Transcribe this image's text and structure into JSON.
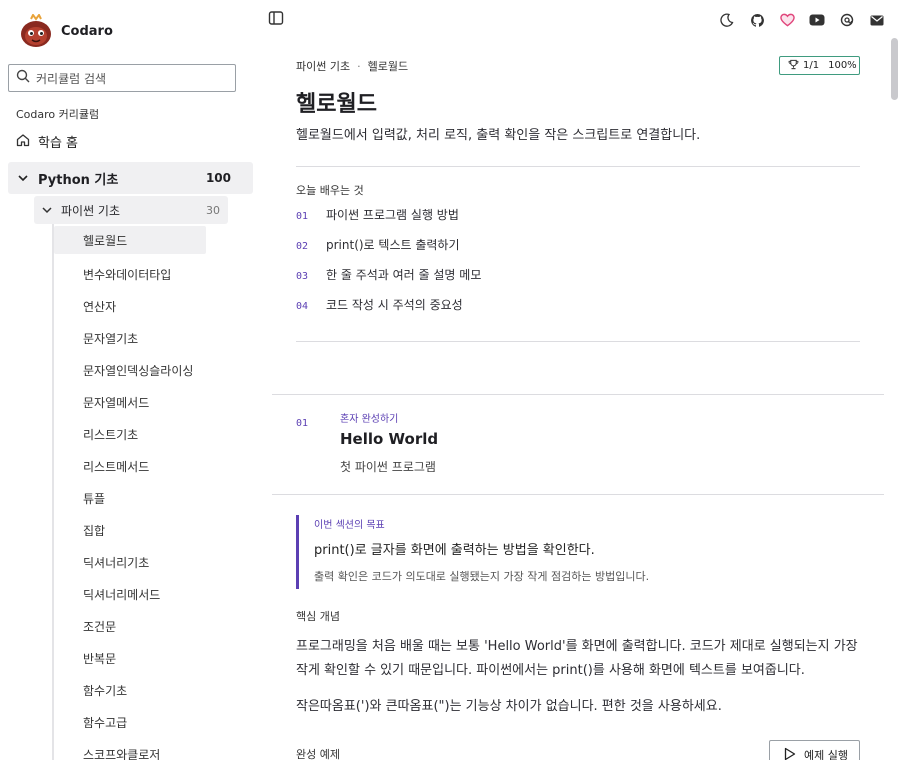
{
  "brand": {
    "name": "Codaro"
  },
  "sidebar": {
    "search_placeholder": "커리큘럼 검색",
    "curriculum_title": "Codaro 커리큘럼",
    "home_label": "학습 홈",
    "group": {
      "label": "Python 기초",
      "count": "100"
    },
    "subgroup": {
      "label": "파이썬 기초",
      "count": "30"
    },
    "lessons": [
      "헬로월드",
      "변수와데이터타입",
      "연산자",
      "문자열기초",
      "문자열인덱싱슬라이싱",
      "문자열메서드",
      "리스트기초",
      "리스트메서드",
      "튜플",
      "집합",
      "딕셔너리기초",
      "딕셔너리메서드",
      "조건문",
      "반복문",
      "함수기초",
      "함수고급",
      "스코프와클로저"
    ]
  },
  "topbar": {
    "icons": [
      "sidebar-toggle-icon",
      "moon-icon",
      "github-icon",
      "heart-icon",
      "youtube-icon",
      "threads-icon",
      "mail-icon"
    ],
    "heart_color": "#e0457b"
  },
  "breadcrumb": {
    "parent": "파이썬 기초",
    "separator": "·",
    "current": "헬로월드"
  },
  "progress": {
    "count": "1/1",
    "percent": "100%"
  },
  "lesson": {
    "title": "헬로월드",
    "lead": "헬로월드에서 입력값, 처리 로직, 출력 확인을 작은 스크립트로 연결합니다.",
    "learn_title": "오늘 배우는 것",
    "objectives": [
      {
        "num": "01",
        "text": "파이썬 프로그램 실행 방법"
      },
      {
        "num": "02",
        "text": "print()로 텍스트 출력하기"
      },
      {
        "num": "03",
        "text": "한 줄 주석과 여러 줄 설명 메모"
      },
      {
        "num": "04",
        "text": "코드 작성 시 주석의 중요성"
      }
    ]
  },
  "section": {
    "num": "01",
    "kicker": "혼자 완성하기",
    "title": "Hello World",
    "subtitle": "첫 파이썬 프로그램",
    "goal_label": "이번 섹션의 목표",
    "goal_main": "print()로 글자를 화면에 출력하는 방법을 확인한다.",
    "goal_sub": "출력 확인은 코드가 의도대로 실행됐는지 가장 작게 점검하는 방법입니다.",
    "core_title": "핵심 개념",
    "para1": "프로그래밍을 처음 배울 때는 보통 'Hello World'를 화면에 출력합니다. 코드가 제대로 실행되는지 가장 작게 확인할 수 있기 때문입니다. 파이썬에서는 print()를 사용해 화면에 텍스트를 보여줍니다.",
    "para2": "작은따옴표(')와 큰따옴표(\")는 기능상 차이가 없습니다. 편한 것을 사용하세요.",
    "example_title": "완성 예제",
    "run_label": "예제 실행"
  },
  "colors": {
    "accent": "#5b3fb3",
    "success": "#3f9b7f"
  }
}
